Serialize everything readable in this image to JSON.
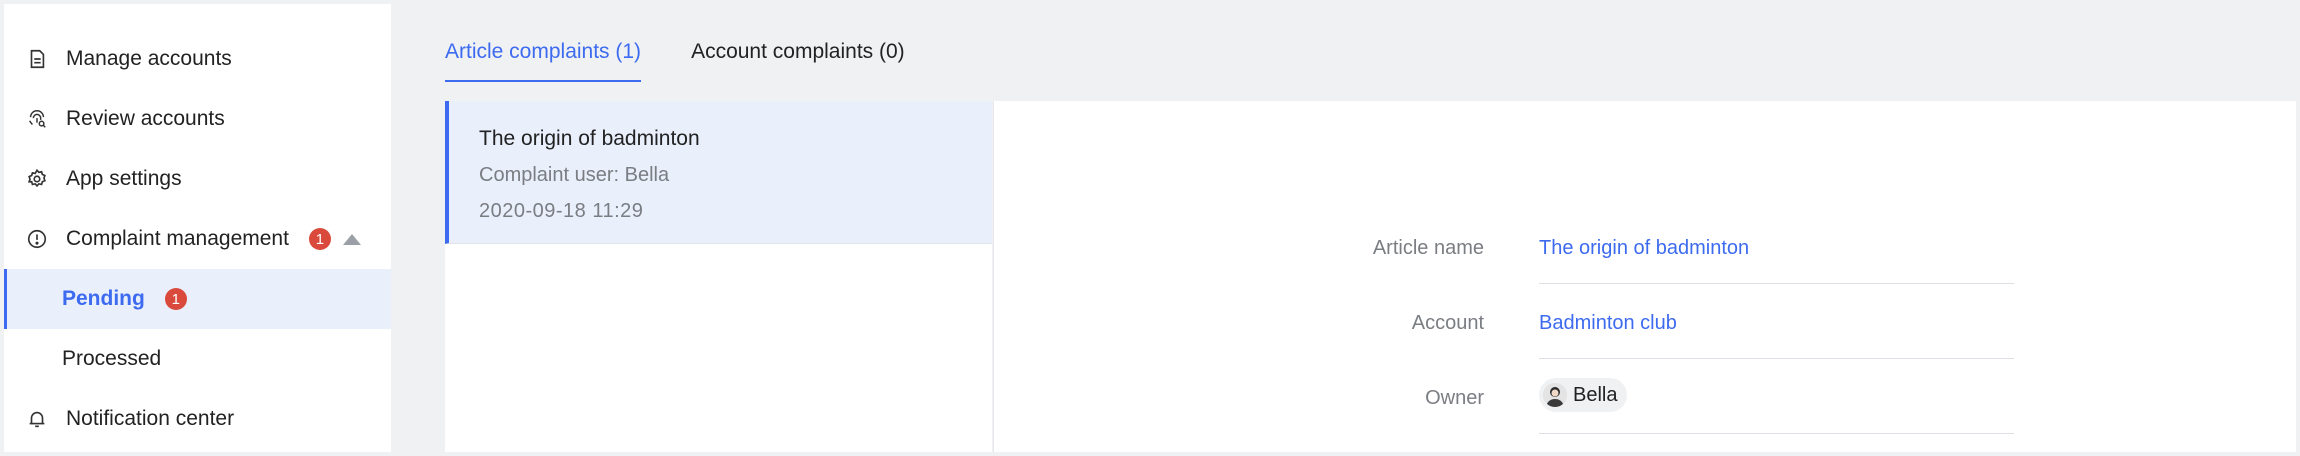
{
  "sidebar": {
    "items": [
      {
        "label": "Manage accounts",
        "icon": "document-icon"
      },
      {
        "label": "Review accounts",
        "icon": "fingerprint-icon"
      },
      {
        "label": "App settings",
        "icon": "gear-icon"
      },
      {
        "label": "Complaint management",
        "icon": "alert-circle-icon",
        "badge": "1",
        "expanded": true
      },
      {
        "label": "Pending",
        "badge": "1",
        "active": true
      },
      {
        "label": "Processed"
      },
      {
        "label": "Notification center",
        "icon": "bell-icon"
      }
    ]
  },
  "tabs": [
    {
      "label": "Article complaints (1)",
      "active": true
    },
    {
      "label": "Account complaints (0)",
      "active": false
    }
  ],
  "list": {
    "items": [
      {
        "title": "The origin of badminton",
        "user": "Complaint user: Bella",
        "date": "2020-09-18 11:29"
      }
    ]
  },
  "detail": {
    "article_label": "Article name",
    "article_value": "The origin of badminton",
    "account_label": "Account",
    "account_value": "Badminton club",
    "owner_label": "Owner",
    "owner_value": "Bella"
  },
  "colors": {
    "accent": "#3d6bf0",
    "badge": "#d94a3c",
    "active_bg": "#eaeffc",
    "page_bg": "#f0f1f3"
  }
}
